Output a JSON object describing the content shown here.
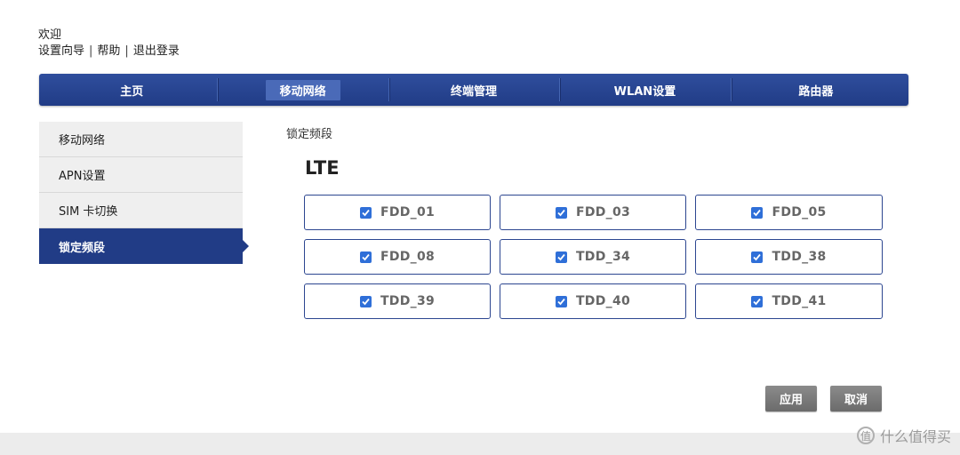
{
  "header": {
    "welcome": "欢迎",
    "links": [
      {
        "label": "设置向导"
      },
      {
        "label": "帮助"
      },
      {
        "label": "退出登录"
      }
    ],
    "separator": "|"
  },
  "nav": {
    "items": [
      {
        "label": "主页",
        "active": false
      },
      {
        "label": "移动网络",
        "active": true
      },
      {
        "label": "终端管理",
        "active": false
      },
      {
        "label": "WLAN设置",
        "active": false
      },
      {
        "label": "路由器",
        "active": false
      }
    ]
  },
  "sidebar": {
    "items": [
      {
        "label": "移动网络",
        "active": false
      },
      {
        "label": "APN设置",
        "active": false
      },
      {
        "label": "SIM 卡切换",
        "active": false
      },
      {
        "label": "锁定频段",
        "active": true
      }
    ]
  },
  "main": {
    "section_title": "锁定频段",
    "lte_title": "LTE",
    "bands": [
      {
        "label": "FDD_01",
        "checked": true
      },
      {
        "label": "FDD_03",
        "checked": true
      },
      {
        "label": "FDD_05",
        "checked": true
      },
      {
        "label": "FDD_08",
        "checked": true
      },
      {
        "label": "TDD_34",
        "checked": true
      },
      {
        "label": "TDD_38",
        "checked": true
      },
      {
        "label": "TDD_39",
        "checked": true
      },
      {
        "label": "TDD_40",
        "checked": true
      },
      {
        "label": "TDD_41",
        "checked": true
      }
    ],
    "apply_label": "应用",
    "cancel_label": "取消"
  },
  "watermark": {
    "icon": "值",
    "text": "什么值得买"
  },
  "colors": {
    "nav_blue": "#213c86",
    "checkbox_blue": "#2f6fd8",
    "button_gray": "#7a7a7a"
  }
}
